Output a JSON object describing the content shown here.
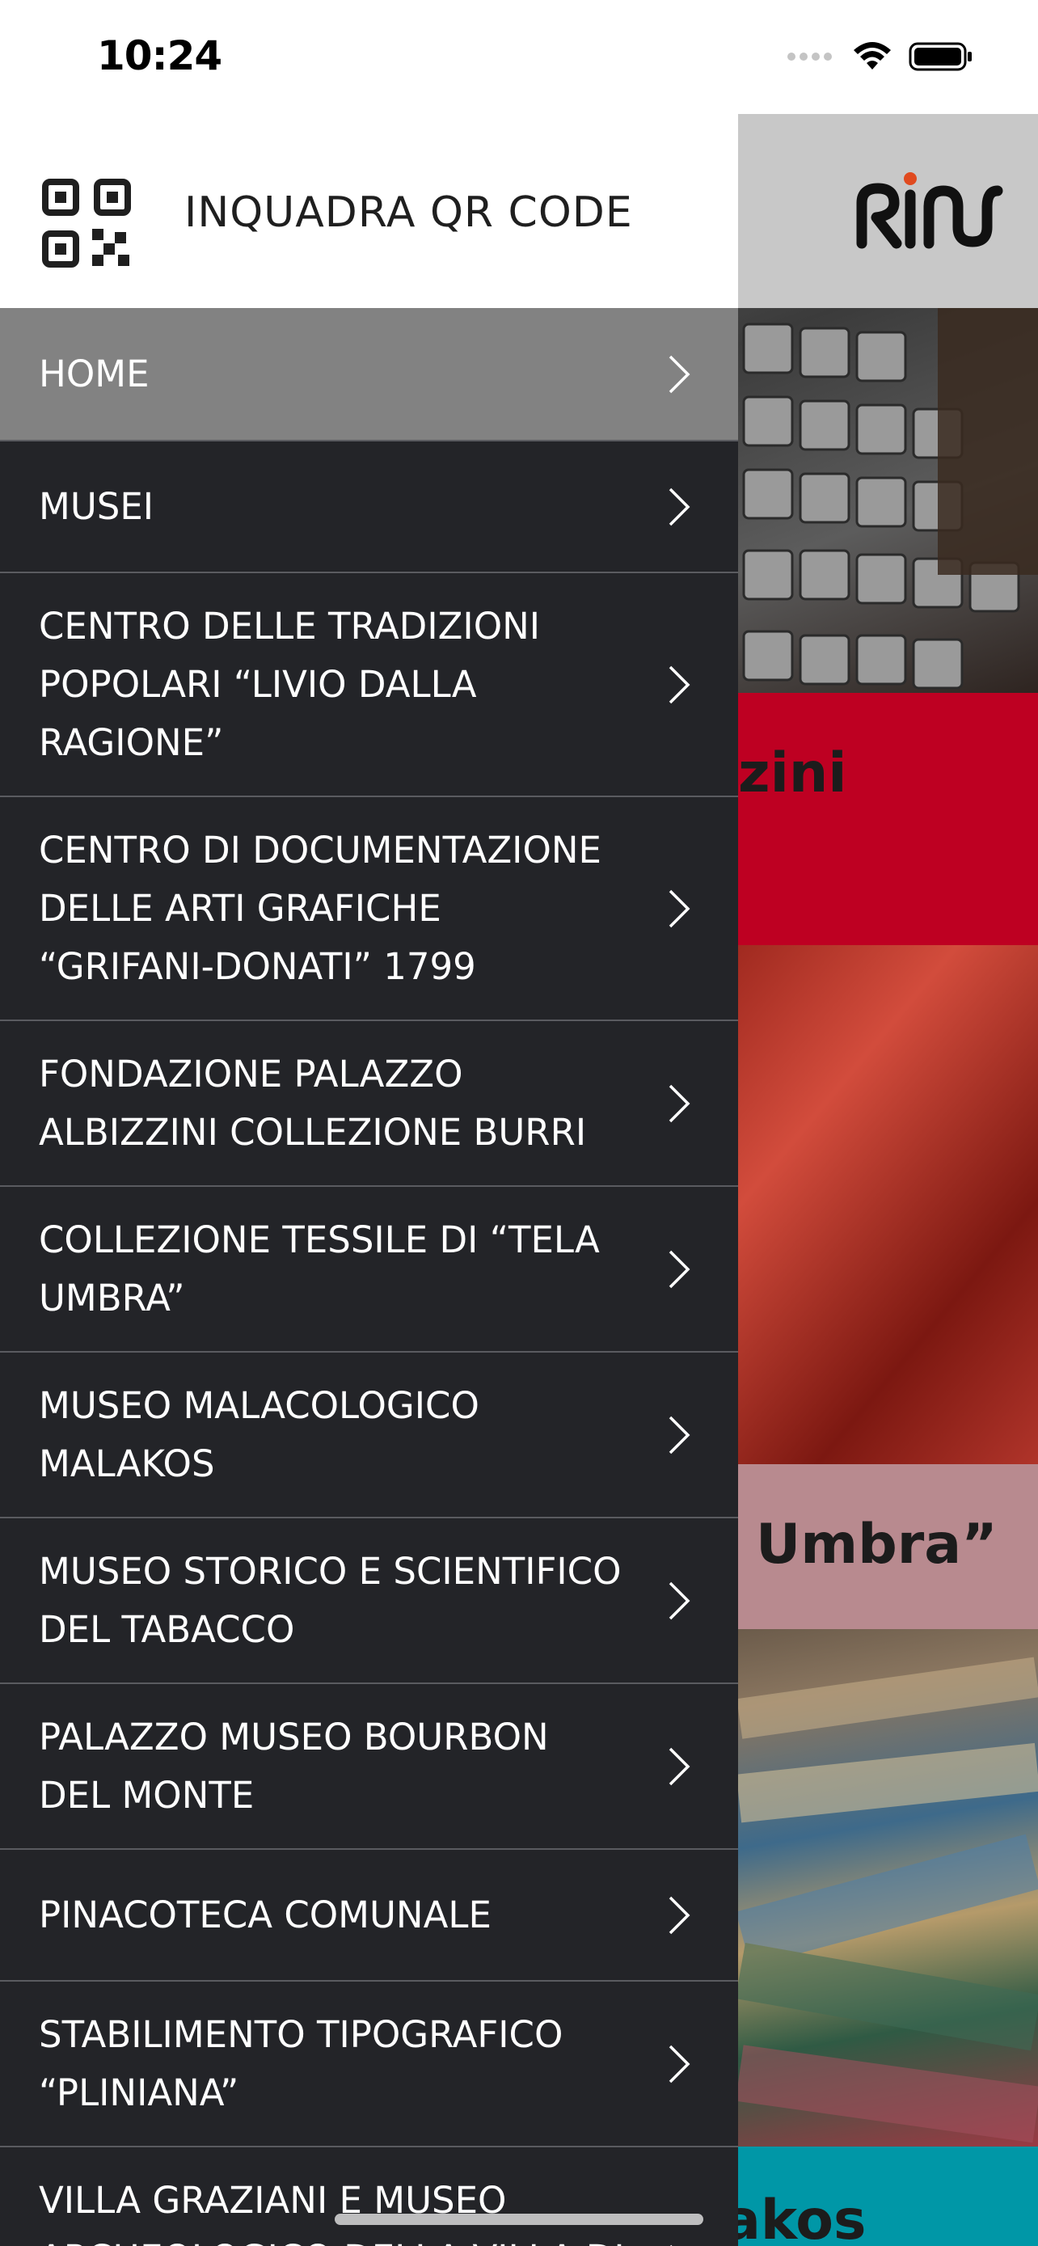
{
  "status_bar": {
    "time": "10:24"
  },
  "qr": {
    "label": "INQUADRA QR CODE"
  },
  "menu": [
    {
      "label": "HOME"
    },
    {
      "label": "MUSEI"
    },
    {
      "label": "CENTRO DELLE TRADIZIONI POPOLARI “LIVIO DALLA RAGIONE”"
    },
    {
      "label": "CENTRO DI DOCUMENTAZIONE DELLE ARTI GRAFICHE “GRIFANI-DONATI” 1799"
    },
    {
      "label": "FONDAZIONE PALAZZO ALBIZZINI COLLEZIONE BURRI"
    },
    {
      "label": "COLLEZIONE TESSILE DI “TELA UMBRA”"
    },
    {
      "label": "MUSEO MALACOLOGICO MALAKOS"
    },
    {
      "label": "MUSEO STORICO E SCIENTIFICO DEL TABACCO"
    },
    {
      "label": "PALAZZO MUSEO BOURBON DEL MONTE"
    },
    {
      "label": "PINACOTECA COMUNALE"
    },
    {
      "label": "STABILIMENTO TIPOGRAFICO “PLINIANA”"
    },
    {
      "label": "VILLA GRAZIANI E MUSEO ARCHEOLOGICO DELLA VILLA DI"
    }
  ],
  "background": {
    "card_titles": [
      "zini",
      "Umbra”",
      "akos"
    ]
  },
  "colors": {
    "drawer_bg": "#232428",
    "active_item": "#828282",
    "red_card": "#be0022",
    "pink_card": "#b88a8f",
    "teal_card": "#0097a7"
  }
}
